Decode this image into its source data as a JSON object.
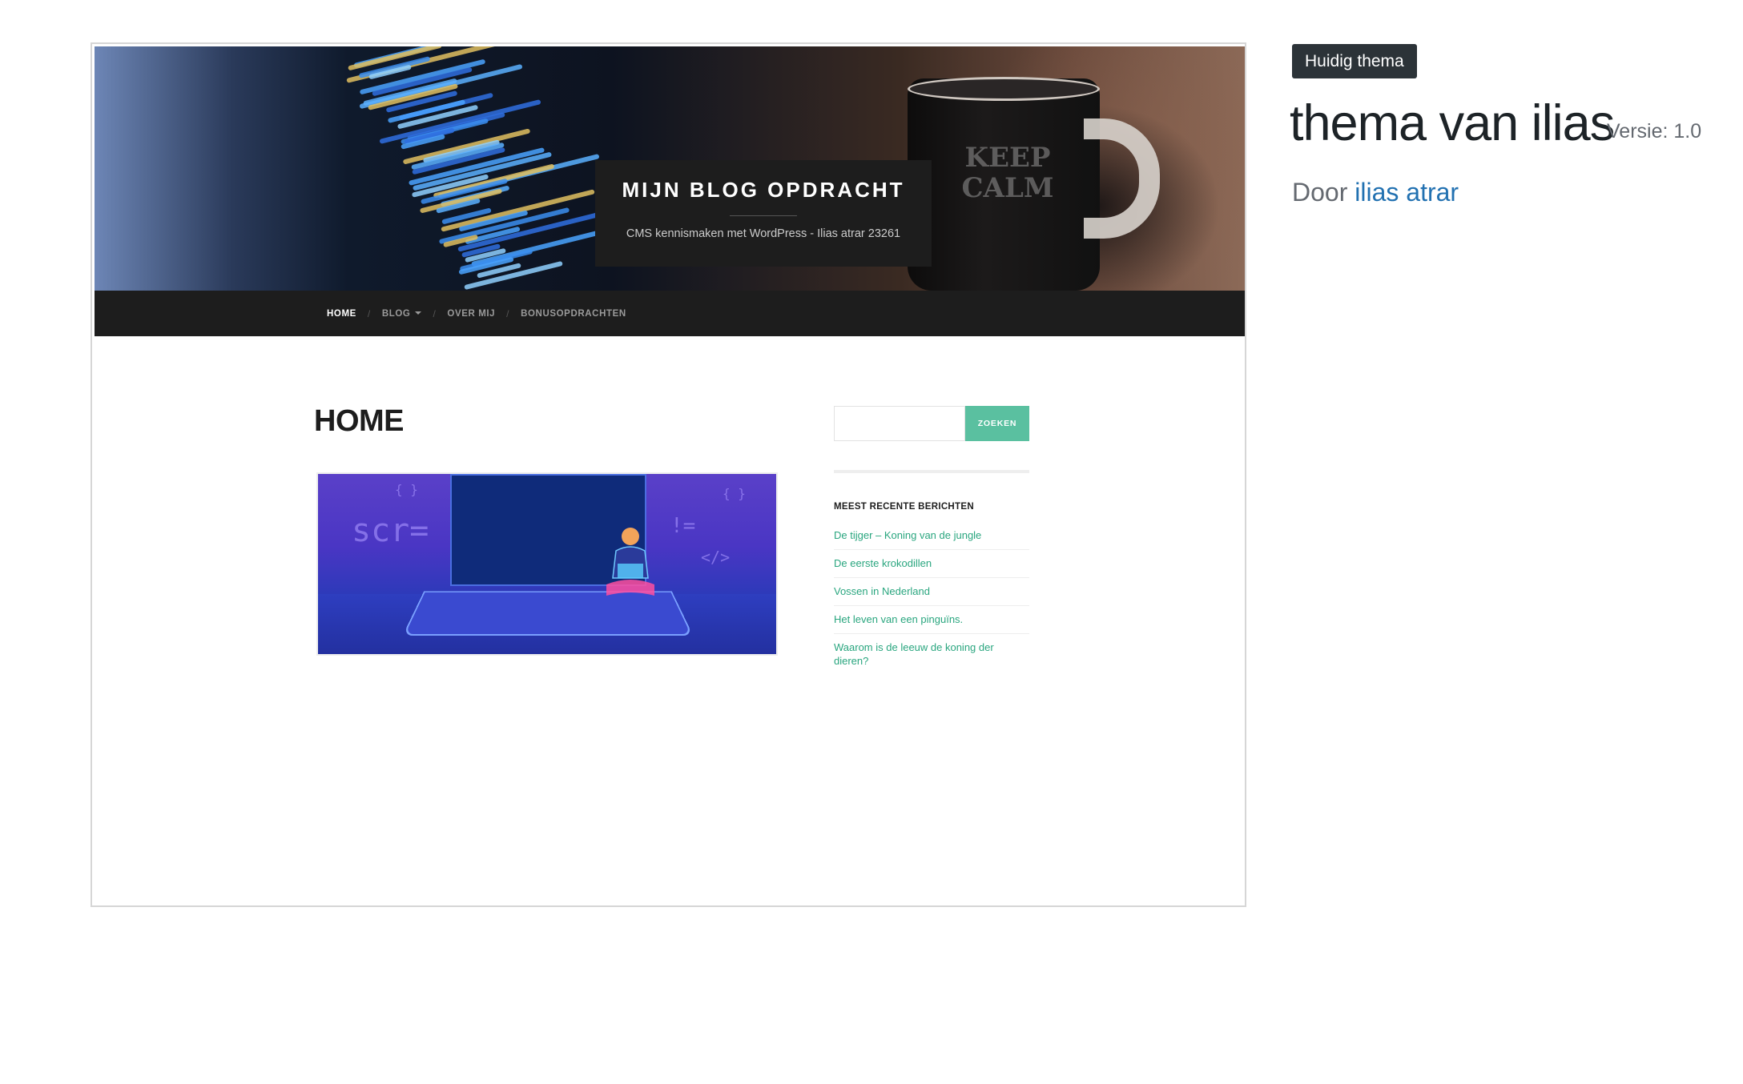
{
  "theme_preview": {
    "site_title": "MIJN BLOG OPDRACHT",
    "site_description": "CMS kennismaken met WordPress - Ilias atrar 23261",
    "header_mug_text": "KEEP CALM",
    "nav": [
      {
        "label": "HOME",
        "active": true
      },
      {
        "label": "BLOG",
        "active": false,
        "dropdown": true
      },
      {
        "label": "OVER MIJ",
        "active": false
      },
      {
        "label": "BONUSOPDRACHTEN",
        "active": false
      }
    ],
    "nav_separator": "/",
    "page_title": "HOME",
    "featured_image": {
      "description": "person with laptop",
      "text_scr": "scr=",
      "text_braces": "{ }",
      "text_neq": "!=",
      "text_tag": "</>"
    },
    "search": {
      "placeholder": "",
      "button_label": "ZOEKEN"
    },
    "recent_posts": {
      "title": "MEEST RECENTE BERICHTEN",
      "items": [
        "De tijger – Koning van de jungle",
        "De eerste krokodillen",
        "Vossen in Nederland",
        "Het leven van een pinguïns.",
        "Waarom is de leeuw de koning der dieren?"
      ]
    },
    "colors": {
      "accent": "#5ac0a0",
      "link": "#2aa67f",
      "header_bg": "#1d1d1d"
    }
  },
  "theme_info": {
    "badge": "Huidig thema",
    "name": "thema van ilias",
    "version": "Versie: 1.0",
    "author_prefix": "Door",
    "author_name": "ilias atrar",
    "colors": {
      "badge_bg": "#2c3338",
      "author_link": "#2271b1"
    }
  }
}
